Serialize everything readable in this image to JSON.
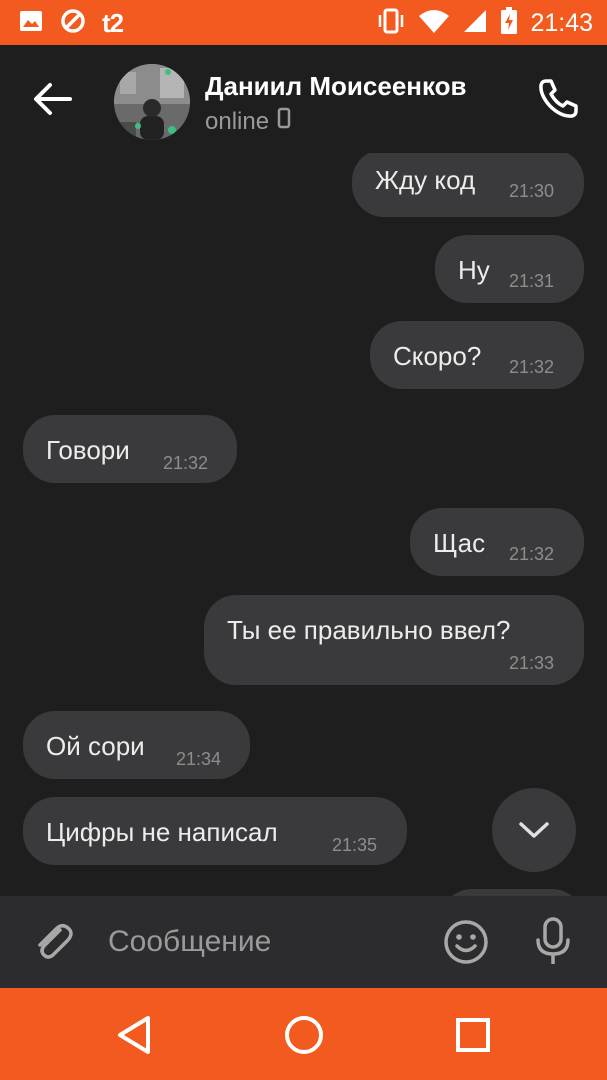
{
  "status_bar": {
    "carrier": "t2",
    "time": "21:43",
    "icons": [
      "image-icon",
      "blocked-icon",
      "vibrate-icon",
      "wifi-icon",
      "signal-icon",
      "battery-charging-icon"
    ]
  },
  "header": {
    "contact_name": "Даниил Моисеенков",
    "contact_status": "online",
    "icons": [
      "back-arrow-icon",
      "phone-icon",
      "mobile-device-icon"
    ]
  },
  "messages": [
    {
      "direction": "outgoing",
      "text": "Жду код",
      "time": "21:30"
    },
    {
      "direction": "outgoing",
      "text": "Ну",
      "time": "21:31"
    },
    {
      "direction": "outgoing",
      "text": "Скоро?",
      "time": "21:32"
    },
    {
      "direction": "incoming",
      "text": "Говори",
      "time": "21:32"
    },
    {
      "direction": "outgoing",
      "text": "Щас",
      "time": "21:32"
    },
    {
      "direction": "outgoing",
      "text": "Ты ее правильно ввел?",
      "time": "21:33"
    },
    {
      "direction": "incoming",
      "text": "Ой сори",
      "time": "21:34"
    },
    {
      "direction": "incoming",
      "text": "Цифры не написал",
      "time": "21:35"
    }
  ],
  "composer": {
    "placeholder": "Сообщение",
    "icons": [
      "paperclip-icon",
      "emoji-icon",
      "microphone-icon"
    ]
  },
  "nav_bar": {
    "icons": [
      "back-triangle-icon",
      "home-circle-icon",
      "recents-square-icon"
    ]
  },
  "colors": {
    "accent": "#f25a1f",
    "background": "#1e1e1e",
    "bubble": "#3a3a3c",
    "composer": "#2c2c2e",
    "muted_text": "#8d8d8d"
  }
}
